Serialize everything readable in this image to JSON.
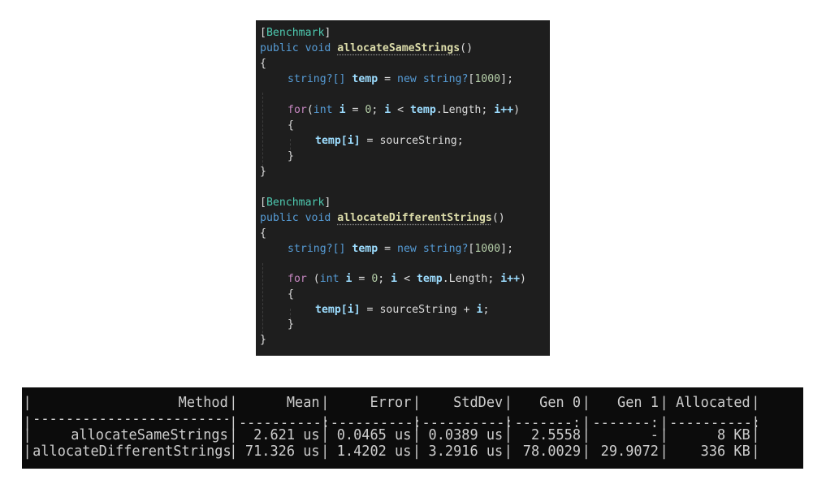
{
  "code": {
    "block1": {
      "attribute": "Benchmark",
      "modifiers": "public void",
      "method_name": "allocateSameStrings",
      "params": "()",
      "open_brace": "{",
      "decl_type": "string?[]",
      "decl_var": "temp",
      "decl_eq": "=",
      "decl_new": "new",
      "decl_type2": "string?",
      "decl_size": "1000",
      "loop_for": "for",
      "loop_paren": "(",
      "loop_int": "int",
      "loop_i": "i",
      "loop_init": "0",
      "loop_cond_var": "temp",
      "loop_cond_prop": ".Length",
      "loop_inc": "i++",
      "inner_open": "{",
      "assign_target": "temp[i]",
      "assign_value": "sourceString;",
      "inner_close": "}",
      "close_brace": "}"
    },
    "block2": {
      "attribute": "Benchmark",
      "modifiers": "public void",
      "method_name": "allocateDifferentStrings",
      "params": "()",
      "open_brace": "{",
      "decl_type": "string?[]",
      "decl_var": "temp",
      "decl_eq": "=",
      "decl_new": "new",
      "decl_type2": "string?",
      "decl_size": "1000",
      "loop_for": "for",
      "loop_paren": " (",
      "loop_int": "int",
      "loop_i": "i",
      "loop_init": "0",
      "loop_cond_var": "temp",
      "loop_cond_prop": ".Length",
      "loop_inc": "i++",
      "inner_open": "{",
      "assign_target": "temp[i]",
      "assign_value": "sourceString + ",
      "assign_suffix": "i",
      "inner_close": "}",
      "close_brace": "}"
    }
  },
  "table": {
    "headers": [
      "Method",
      "Mean",
      "Error",
      "StdDev",
      "Gen 0",
      "Gen 1",
      "Allocated"
    ],
    "separator": [
      "-------------------------",
      "----------:",
      "----------:",
      "----------:",
      "-------:",
      "-------:",
      "----------:"
    ],
    "rows": [
      [
        "allocateSameStrings",
        "2.621 us",
        "0.0465 us",
        "0.0389 us",
        "2.5558",
        "-",
        "8 KB"
      ],
      [
        "allocateDifferentStrings",
        "71.326 us",
        "1.4202 us",
        "3.2916 us",
        "78.0029",
        "29.9072",
        "336 KB"
      ]
    ]
  }
}
